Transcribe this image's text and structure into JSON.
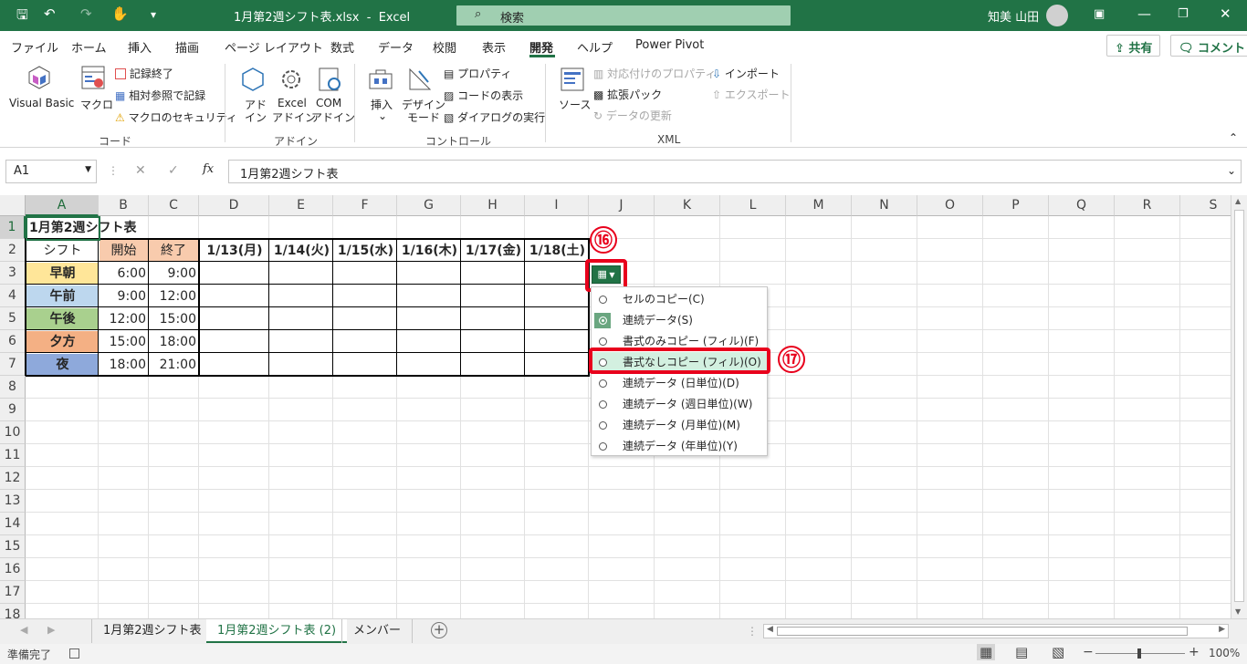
{
  "window": {
    "filename": "1月第2週シフト表.xlsx",
    "app": "Excel",
    "search_placeholder": "検索",
    "user": "知美 山田"
  },
  "menu": {
    "tabs": [
      "ファイル",
      "ホーム",
      "挿入",
      "描画",
      "ページ レイアウト",
      "数式",
      "データ",
      "校閲",
      "表示",
      "開発",
      "ヘルプ",
      "Power Pivot"
    ],
    "active_tab": "開発",
    "share_label": "共有",
    "comment_label": "コメント"
  },
  "ribbon": {
    "code": {
      "vba": "Visual Basic",
      "macro": "マクロ",
      "record": "記録終了",
      "relative": "相対参照で記録",
      "security": "マクロのセキュリティ",
      "group": "コード"
    },
    "addins": {
      "addin1": "アド",
      "addin2": "イン",
      "excel1": "Excel",
      "excel2": "アドイン",
      "com1": "COM",
      "com2": "アドイン",
      "group": "アドイン"
    },
    "controls": {
      "insert": "挿入",
      "design1": "デザイン",
      "design2": "モード",
      "properties": "プロパティ",
      "viewcode": "コードの表示",
      "dialog": "ダイアログの実行",
      "group": "コントロール"
    },
    "xml": {
      "source": "ソース",
      "mapprops": "対応付けのプロパティ",
      "expansion": "拡張パック",
      "refresh": "データの更新",
      "import": "インポート",
      "export": "エクスポート",
      "group": "XML"
    }
  },
  "formula_bar": {
    "name_box": "A1",
    "fx": "fx",
    "content": "1月第2週シフト表"
  },
  "columns": [
    "A",
    "B",
    "C",
    "D",
    "E",
    "F",
    "G",
    "H",
    "I",
    "J",
    "K",
    "L",
    "M",
    "N",
    "O",
    "P",
    "Q",
    "R",
    "S"
  ],
  "rows": [
    "1",
    "2",
    "3",
    "4",
    "5",
    "6",
    "7",
    "8",
    "9",
    "10",
    "11",
    "12",
    "13",
    "14",
    "15",
    "16",
    "17",
    "18"
  ],
  "sheet": {
    "title": "1月第2週シフト表",
    "header": {
      "shift": "シフト",
      "start": "開始",
      "end": "終了",
      "dates": [
        "1/13(月)",
        "1/14(火)",
        "1/15(水)",
        "1/16(木)",
        "1/17(金)",
        "1/18(土)"
      ]
    },
    "shifts": [
      {
        "name": "早朝",
        "start": "6:00",
        "end": "9:00",
        "color": "#ffe699"
      },
      {
        "name": "午前",
        "start": "9:00",
        "end": "12:00",
        "color": "#bdd7ee"
      },
      {
        "name": "午後",
        "start": "12:00",
        "end": "15:00",
        "color": "#a9d08e"
      },
      {
        "name": "夕方",
        "start": "15:00",
        "end": "18:00",
        "color": "#f4b084"
      },
      {
        "name": "夜",
        "start": "18:00",
        "end": "21:00",
        "color": "#8ea9db"
      }
    ],
    "time_header_color": "#f8cbad"
  },
  "autofill_menu": {
    "items": [
      "セルのコピー(C)",
      "連続データ(S)",
      "書式のみコピー (フィル)(F)",
      "書式なしコピー (フィル)(O)",
      "連続データ (日単位)(D)",
      "連続データ (週日単位)(W)",
      "連続データ (月単位)(M)",
      "連続データ (年単位)(Y)"
    ],
    "selected_index": 1,
    "highlighted_index": 3
  },
  "callouts": {
    "step16": "⑯",
    "step17": "⑰"
  },
  "sheet_tabs": [
    "1月第2週シフト表",
    "1月第2週シフト表 (2)",
    "メンバー"
  ],
  "active_sheet_index": 1,
  "status": {
    "ready": "準備完了",
    "zoom": "100%"
  }
}
